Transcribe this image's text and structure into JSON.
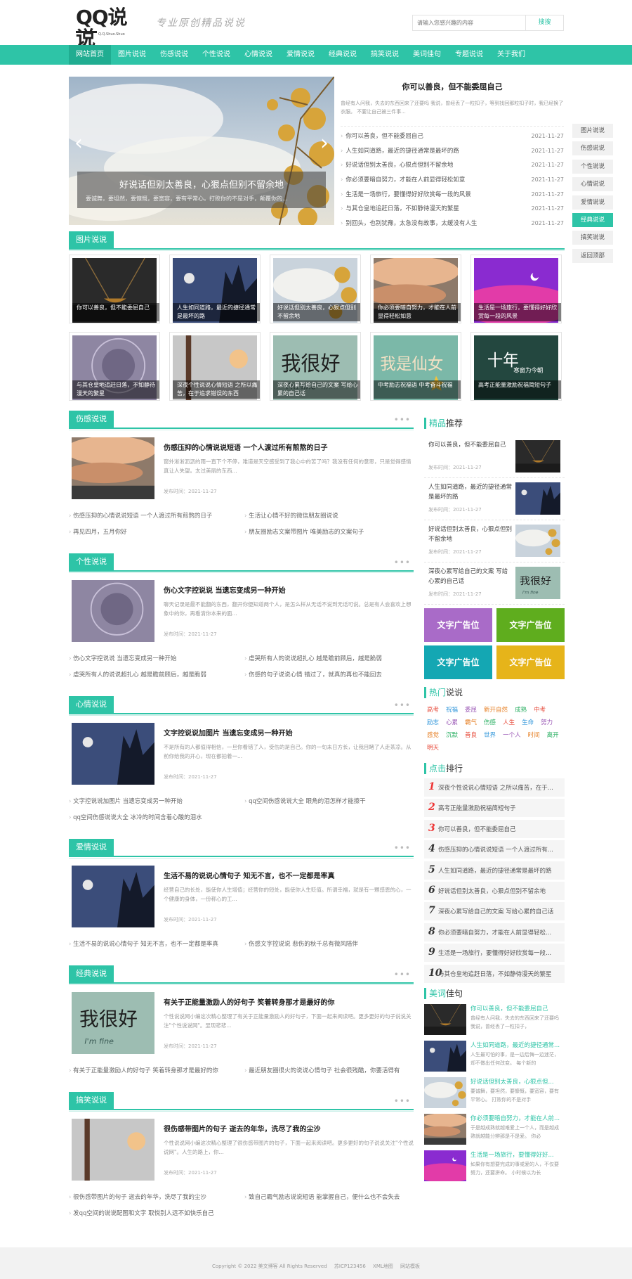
{
  "header": {
    "logo_text": "QQ说说",
    "logo_sub": "Q.Q.Shuo.Shuo",
    "slogan": "专业原创精品说说",
    "search_placeholder": "请输入您感兴趣的内容",
    "search_button": "搜搜"
  },
  "nav": {
    "items": [
      "网站首页",
      "图片说说",
      "伤感说说",
      "个性说说",
      "心情说说",
      "爱情说说",
      "经典说说",
      "搞笑说说",
      "美词佳句",
      "专题说说",
      "关于我们"
    ]
  },
  "slider": {
    "title": "好说话但别太善良，心狠点但别不留余地",
    "desc": "要诚舞，要坦然，要慷慨，要宽容，要有平常心。打败你的不是对手，颠覆你的..."
  },
  "top_news": {
    "headline": "你可以善良，但不能委屈自己",
    "desc": "曾经有人问我，失去的东西回来了还要吗 我说，曾经丢了一粒扣子，等到找回那粒扣子时，我已经换了衣服。 不要让自己被三件事...",
    "list": [
      {
        "title": "你可以善良，但不能委屈自己",
        "date": "2021-11-27"
      },
      {
        "title": "人生如同道路，最近的捷径通常是最坏的路",
        "date": "2021-11-27"
      },
      {
        "title": "好说话但别太善良，心狠点但别不留余地",
        "date": "2021-11-27"
      },
      {
        "title": "你必须要暗自努力，才能在人前显得轻松如意",
        "date": "2021-11-27"
      },
      {
        "title": "生活是一场旅行，要懂得好好欣赏每一段的风景",
        "date": "2021-11-27"
      },
      {
        "title": "与其仓皇地追赶日落，不如静待漫天的繁星",
        "date": "2021-11-27"
      },
      {
        "title": "别回头，也别犹豫，太急没有故事，太缓没有人生",
        "date": "2021-11-27"
      }
    ]
  },
  "side_menu": [
    "图片说说",
    "伤感说说",
    "个性说说",
    "心情说说",
    "爱情说说",
    "经典说说",
    "搞笑说说",
    "返回顶部"
  ],
  "pic_section": {
    "title": "图片说说",
    "cards": [
      {
        "label": "你可以善良，但不能委屈自己"
      },
      {
        "label": "人生如同道路，最近的捷径通常是最坏的路"
      },
      {
        "label": "好说话但别太善良，心狠点但别不留余地"
      },
      {
        "label": "你必须要暗自努力，才能在人前显得轻松如意"
      },
      {
        "label": "生活是一场旅行，要懂得好好欣赏每一段的风景"
      },
      {
        "label": "与其仓皇地追赶日落，不如静待漫天的繁星"
      },
      {
        "label": "深夜个性说说心情短语 之所以痛苦，在于追求错误的东西"
      },
      {
        "label": "深夜心累写给自己的文案 写给心累的自己话"
      },
      {
        "label": "中考励志祝福语 中考奋斗祝福"
      },
      {
        "label": "高考正能量激励祝福简短句子"
      }
    ]
  },
  "sections": [
    {
      "title": "伤感说说",
      "article": {
        "title": "伤感压抑的心情说说短语 一个人渡过所有煎熬的日子",
        "desc": "窗外淅淅沥沥的雨一直下个不停，难道是天空感受到了我心中的苦了吗？我没有任何的意思，只是觉得感情真让人失望。太过美丽的东西...",
        "date": "发布时间：2021-11-27"
      },
      "links": [
        "伤感压抑的心情说说短语 一个人渡过所有煎熬的日子",
        "生活让心情不好的微信朋友圈说说",
        "再见四月，五月你好",
        "朋友圈励志文案带图片 唯美励志的文案句子"
      ]
    },
    {
      "title": "个性说说",
      "article": {
        "title": "伤心文字控说说 当遗忘变成另一种开始",
        "desc": "聊天记录是最不能翻的东西，翻开你便知道两个人，是怎么样从无话不说到无话可说。总是有人会喜欢上想象中的你，再看清你本来的面...",
        "date": "发布时间：2021-11-27"
      },
      "links": [
        "伤心文字控说说 当遗忘变成另一种开始",
        "虐哭所有人的说说超扎心 越是瞻前顾后，越是脆弱",
        "虐哭所有人的说说超扎心 越是瞻前顾后，越是脆弱",
        "伤感的句子说说心情 错过了，就真的再也不能回去"
      ]
    },
    {
      "title": "心情说说",
      "article": {
        "title": "文字控说说加图片 当遗忘变成另一种开始",
        "desc": "不是所有的人都值得相信，一旦你看错了人，受伤的是自己。你的一句未日方长，让我目睹了人走茶凉。从前你给我的开心，现在都拍着一...",
        "date": "发布时间：2021-11-27"
      },
      "links": [
        "文字控说说加图片 当遗忘变成另一种开始",
        "qq空间伤感说说大全 眼角的泪怎样才能擦干",
        "qq空间伤感说说大全 冰冷的时间含着心酸的泪水"
      ]
    },
    {
      "title": "爱情说说",
      "article": {
        "title": "生活不易的说说心情句子 知无不言，也不一定都是率真",
        "desc": "经营自己的长处，能使你人生增值；经营你的短处，能使你人生贬值。所谓幸福，就是有一颗感恩的心，一个健康的身体，一份称心的工...",
        "date": "发布时间：2021-11-27"
      },
      "links": [
        "生活不易的说说心情句子 知无不言，也不一定都是率真",
        "伤感文字控说说 悲伤的秋千总有微风陪伴"
      ]
    },
    {
      "title": "经典说说",
      "article": {
        "title": "有关于正能量激励人的好句子 笑着转身那才是最好的你",
        "desc": "个性说说网小编这次精心整理了有关于正能量激励人的好句子，下面一起来阅读吧。更多更好的句子说说关注\"个性说说网\"。显现悲悲...",
        "date": "发布时间：2021-11-27"
      },
      "links": [
        "有关于正能量激励人的好句子 笑着转身那才是最好的你",
        "最近朋友圈很火的说说心情句子 社会很残酷，你要活得有"
      ]
    },
    {
      "title": "搞笑说说",
      "article": {
        "title": "很伤感带图片的句子 逝去的年华，洗尽了我的尘沙",
        "desc": "个性说说网小编这次精心整理了很伤感带图片的句子，下面一起来阅读吧。更多更好的句子说说关注\"个性说说网\"。人生的路上，你...",
        "date": "发布时间：2021-11-27"
      },
      "links": [
        "很伤感带图片的句子 逝去的年华，洗尽了我的尘沙",
        "致自己霸气励志说说短语 能掌握自己，便什么也不会失去",
        "发qq空间的说说配图和文字 取悦别人远不如快乐自己"
      ]
    }
  ],
  "recommend": {
    "title_accent": "精品",
    "title_rest": "推荐",
    "items": [
      {
        "title": "你可以善良，但不能委屈自己",
        "date": "发布时间：2021-11-27"
      },
      {
        "title": "人生如同道路，最近的捷径通常是最坏的路",
        "date": "发布时间：2021-11-27"
      },
      {
        "title": "好说话但别太善良，心狠点但别不留余地",
        "date": "发布时间：2021-11-27"
      },
      {
        "title": "深夜心累写给自己的文案 写给心累的自己话",
        "date": "发布时间：2021-11-27"
      }
    ]
  },
  "ads": [
    "文字广告位",
    "文字广告位",
    "文字广告位",
    "文字广告位"
  ],
  "hot": {
    "title_accent": "热门",
    "title_rest": "说说",
    "tags": [
      {
        "text": "高考",
        "color": "#e74c3c"
      },
      {
        "text": "祝福",
        "color": "#3498db"
      },
      {
        "text": "委屈",
        "color": "#9b59b6"
      },
      {
        "text": "新开自然",
        "color": "#e67e22"
      },
      {
        "text": "成熟",
        "color": "#27ae60"
      },
      {
        "text": "中考",
        "color": "#e74c3c"
      },
      {
        "text": "励志",
        "color": "#3498db"
      },
      {
        "text": "心累",
        "color": "#9b59b6"
      },
      {
        "text": "霸气",
        "color": "#e67e22"
      },
      {
        "text": "伤感",
        "color": "#27ae60"
      },
      {
        "text": "人生",
        "color": "#e74c3c"
      },
      {
        "text": "生命",
        "color": "#3498db"
      },
      {
        "text": "努力",
        "color": "#9b59b6"
      },
      {
        "text": "感觉",
        "color": "#e67e22"
      },
      {
        "text": "沉默",
        "color": "#27ae60"
      },
      {
        "text": "善良",
        "color": "#e74c3c"
      },
      {
        "text": "世界",
        "color": "#3498db"
      },
      {
        "text": "一个人",
        "color": "#9b59b6"
      },
      {
        "text": "时间",
        "color": "#e67e22"
      },
      {
        "text": "离开",
        "color": "#27ae60"
      },
      {
        "text": "明天",
        "color": "#e74c3c"
      }
    ]
  },
  "ranking": {
    "title_accent": "点击",
    "title_rest": "排行",
    "items": [
      "深夜个性说说心情短语 之所以痛苦，在于...",
      "高考正能量激励祝福简短句子",
      "你可以善良，但不能委屈自己",
      "伤感压抑的心情说说短语 一个人渡过所有...",
      "人生如同道路，最近的捷径通常是最坏的路",
      "好说话但别太善良，心狠点但别不留余地",
      "深夜心累写给自己的文案 写给心累的自己话",
      "你必须要暗自努力，才能在人前显得轻松...",
      "生活是一场旅行，要懂得好好欣赏每一段...",
      "与其仓皇地追赶日落，不如静待漫天的繁星"
    ]
  },
  "meici": {
    "title_accent": "美词",
    "title_rest": "佳句",
    "items": [
      {
        "title": "你可以善良，但不能委屈自己",
        "desc": "曾经有人问我，失去的东西回来了还要吗 我说，曾经丢了一粒扣子，"
      },
      {
        "title": "人生如同道路，最近的捷径通常...",
        "desc": "人生最可怕的事，是一边后悔一边迷茫，却不做出任何改变。 每个新的"
      },
      {
        "title": "好说话但别太善良，心狠点但...",
        "desc": "要诚舞，要坦然，要慷慨，要宽容，要有平常心。 打败你的不是对手"
      },
      {
        "title": "你必须要暗自努力，才能在人前...",
        "desc": "于是越成熟就越难爱上一个人，而是越成熟就越能分辨那是不是爱。 你必"
      },
      {
        "title": "生活是一场旅行，要懂得好好...",
        "desc": "如果你有想要完成的事或爱的人，不仅要努力，还要拼命。 小时候以为长"
      }
    ]
  },
  "footer": {
    "copyright": "Copyright © 2022 美文博客 All Rights Reserved",
    "icp": "苏ICP123456",
    "map": "XML地图",
    "tpl": "网站模板"
  }
}
